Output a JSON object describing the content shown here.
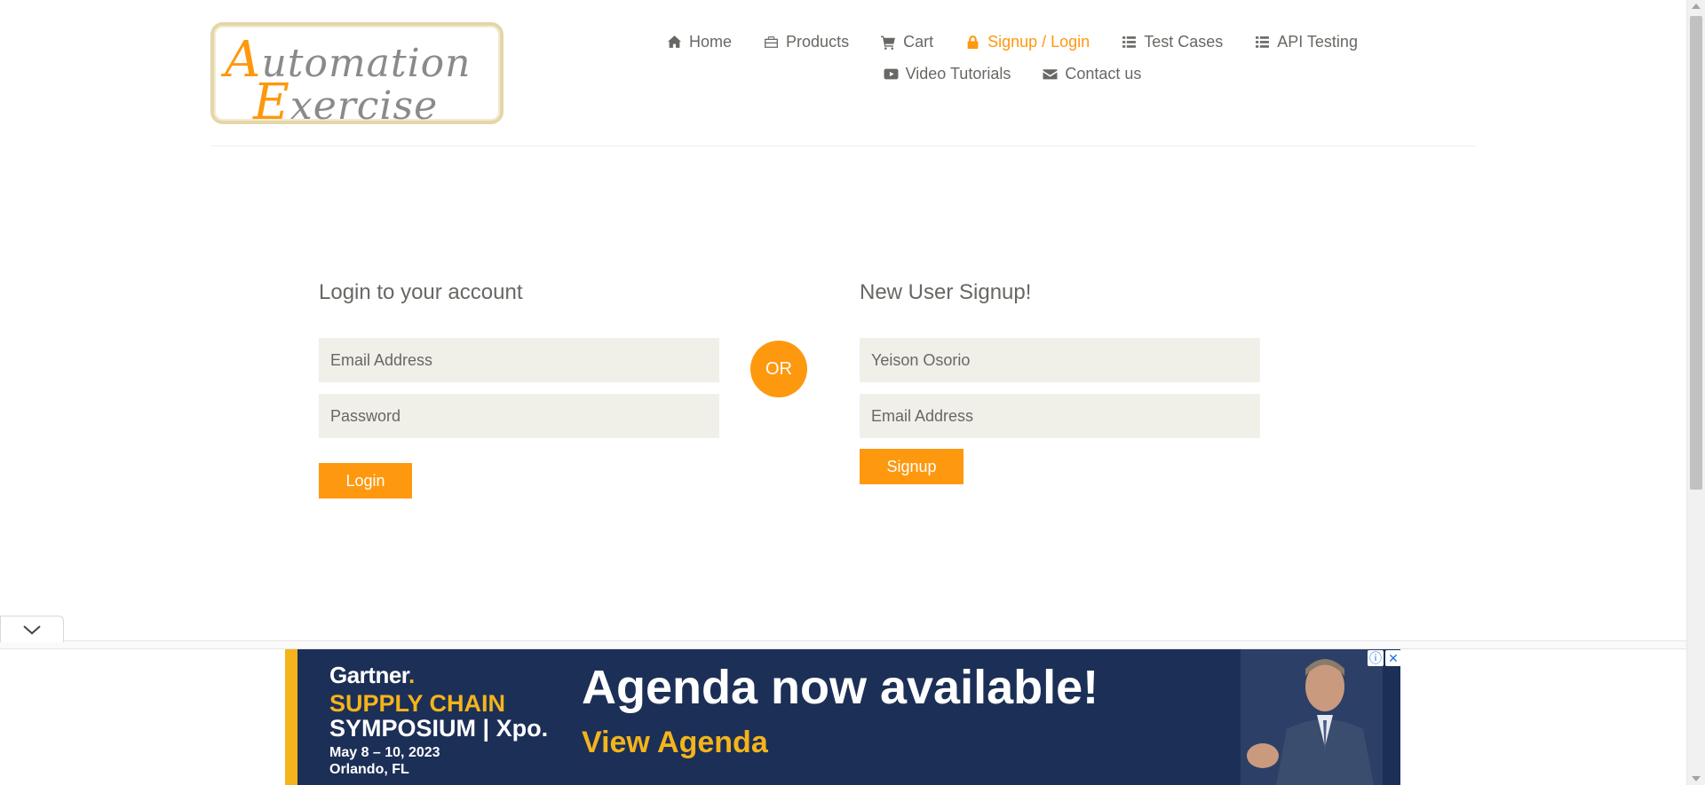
{
  "header": {
    "logo": {
      "line1_cap": "A",
      "line1_rest": "utomation",
      "line2_cap": "E",
      "line2_rest": "xercise"
    },
    "nav": [
      {
        "label": "Home",
        "icon": "home-icon"
      },
      {
        "label": "Products",
        "icon": "briefcase-icon"
      },
      {
        "label": "Cart",
        "icon": "cart-icon"
      },
      {
        "label": "Signup / Login",
        "icon": "lock-icon",
        "active": true
      },
      {
        "label": "Test Cases",
        "icon": "list-icon"
      },
      {
        "label": "API Testing",
        "icon": "list-icon"
      },
      {
        "label": "Video Tutorials",
        "icon": "youtube-play-icon"
      },
      {
        "label": "Contact us",
        "icon": "envelope-icon"
      }
    ]
  },
  "login": {
    "title": "Login to your account",
    "email_placeholder": "Email Address",
    "password_placeholder": "Password",
    "button": "Login"
  },
  "or_label": "OR",
  "signup": {
    "title": "New User Signup!",
    "name_value": "Yeison Osorio",
    "email_placeholder": "Email Address",
    "button": "Signup"
  },
  "ad": {
    "brand": "Gartner",
    "event_line1": "SUPPLY CHAIN",
    "event_line2": "SYMPOSIUM | Xpo.",
    "dates": "May 8 – 10, 2023",
    "location": "Orlando, FL",
    "headline": "Agenda now available!",
    "cta": "View Agenda"
  },
  "colors": {
    "accent": "#fe980f",
    "input_bg": "#f0f0e9",
    "text": "#696763",
    "ad_bg": "#1c2f57",
    "ad_yellow": "#f4b41a"
  }
}
